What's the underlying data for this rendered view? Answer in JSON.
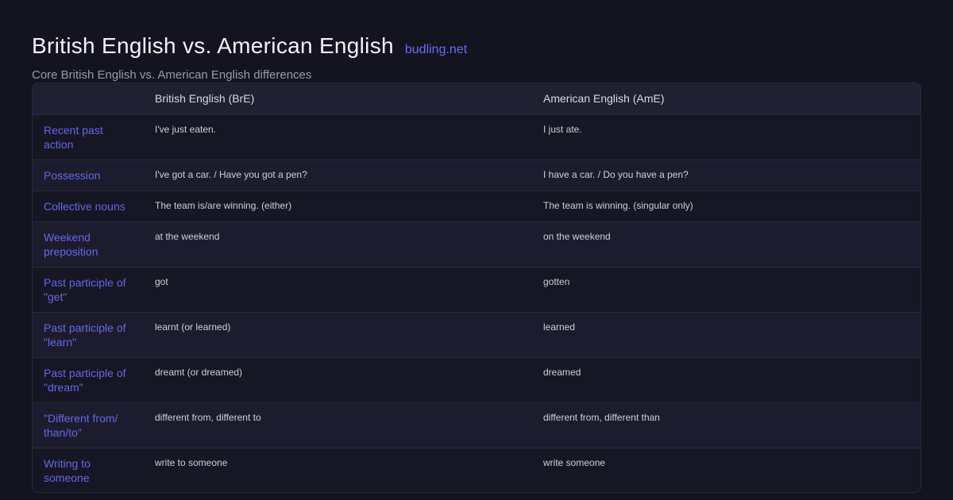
{
  "header": {
    "title": "British English vs. American English",
    "site": "budling.net",
    "subtitle": "Core British English vs. American English differences"
  },
  "table": {
    "columns": [
      "",
      "British English (BrE)",
      "American English (AmE)"
    ],
    "rows": [
      {
        "label": "Recent past action",
        "bre": "I've just eaten.",
        "ame": "I just ate."
      },
      {
        "label": "Possession",
        "bre": "I've got a car. / Have you got a pen?",
        "ame": "I have a car. / Do you have a pen?"
      },
      {
        "label": "Collective nouns",
        "bre": "The team is/are winning. (either)",
        "ame": "The team is winning. (singular only)"
      },
      {
        "label": "Weekend preposition",
        "bre": "at the weekend",
        "ame": "on the weekend"
      },
      {
        "label": "Past participle of \"get\"",
        "bre": "got",
        "ame": "gotten"
      },
      {
        "label": "Past participle of \"learn\"",
        "bre": "learnt (or learned)",
        "ame": "learned"
      },
      {
        "label": "Past participle of \"dream\"",
        "bre": "dreamt (or dreamed)",
        "ame": "dreamed"
      },
      {
        "label": "\"Different from/ than/to\"",
        "bre": "different  from, different  to",
        "ame": "different  from, different  than"
      },
      {
        "label": "Writing to someone",
        "bre": "write to someone",
        "ame": "write someone"
      }
    ]
  }
}
